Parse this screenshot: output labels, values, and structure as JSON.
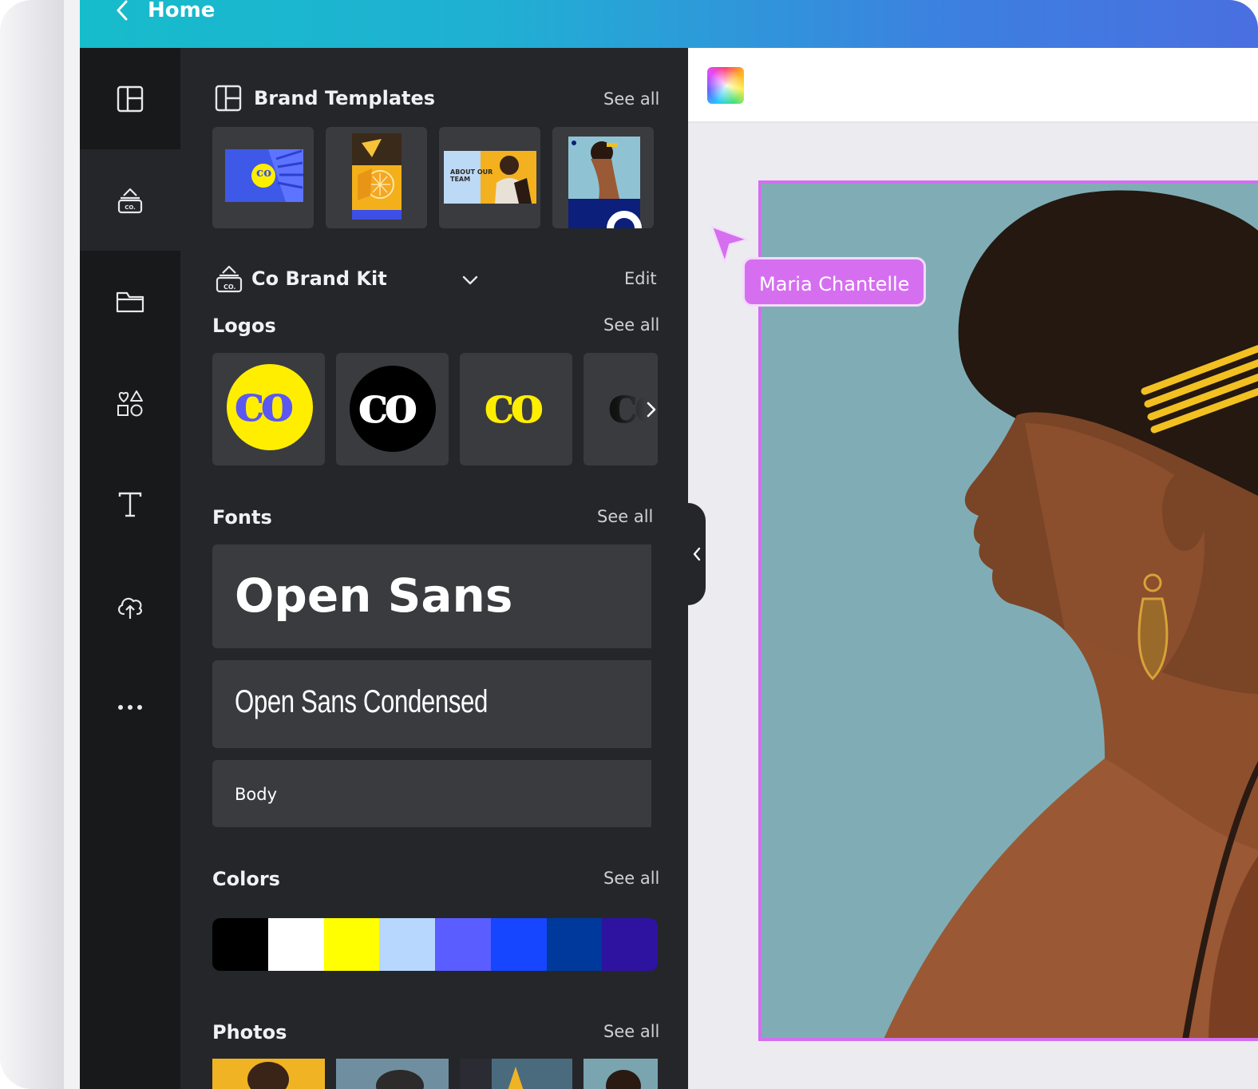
{
  "header": {
    "back_label": "Home"
  },
  "rail": {
    "items": [
      {
        "name": "templates",
        "icon": "layout-icon"
      },
      {
        "name": "brand",
        "icon": "brand-kit-icon"
      },
      {
        "name": "projects",
        "icon": "folder-icon"
      },
      {
        "name": "elements",
        "icon": "shapes-icon"
      },
      {
        "name": "text",
        "icon": "text-icon"
      },
      {
        "name": "uploads",
        "icon": "cloud-upload-icon"
      },
      {
        "name": "more",
        "icon": "more-dots-icon"
      }
    ]
  },
  "panel": {
    "brand_templates": {
      "title": "Brand Templates",
      "see_all": "See all",
      "tile3_text": "ABOUT OUR TEAM",
      "tile1_text": "co"
    },
    "brand_kit": {
      "title": "Co Brand Kit",
      "edit": "Edit",
      "icon_text": "CO."
    },
    "logos": {
      "title": "Logos",
      "see_all": "See all",
      "items": [
        {
          "text": "co",
          "style": "yellow-circle"
        },
        {
          "text": "co",
          "style": "black-circle"
        },
        {
          "text": "co",
          "style": "yellow-text"
        },
        {
          "text": "co",
          "style": "partial"
        }
      ]
    },
    "fonts": {
      "title": "Fonts",
      "see_all": "See all",
      "items": [
        "Open Sans",
        "Open Sans Condensed",
        "Body"
      ]
    },
    "colors": {
      "title": "Colors",
      "see_all": "See all",
      "swatches": [
        "#000000",
        "#ffffff",
        "#ffff00",
        "#b7d7ff",
        "#5a5dff",
        "#1646ff",
        "#00399c",
        "#2d13a0"
      ]
    },
    "photos": {
      "title": "Photos",
      "see_all": "See all"
    }
  },
  "collaborator": {
    "name": "Maria Chantelle",
    "color": "#d56ff0"
  },
  "accent": {
    "topbar_start": "#16bccb",
    "topbar_end": "#4a6fe0",
    "selection": "#d36ff0"
  }
}
